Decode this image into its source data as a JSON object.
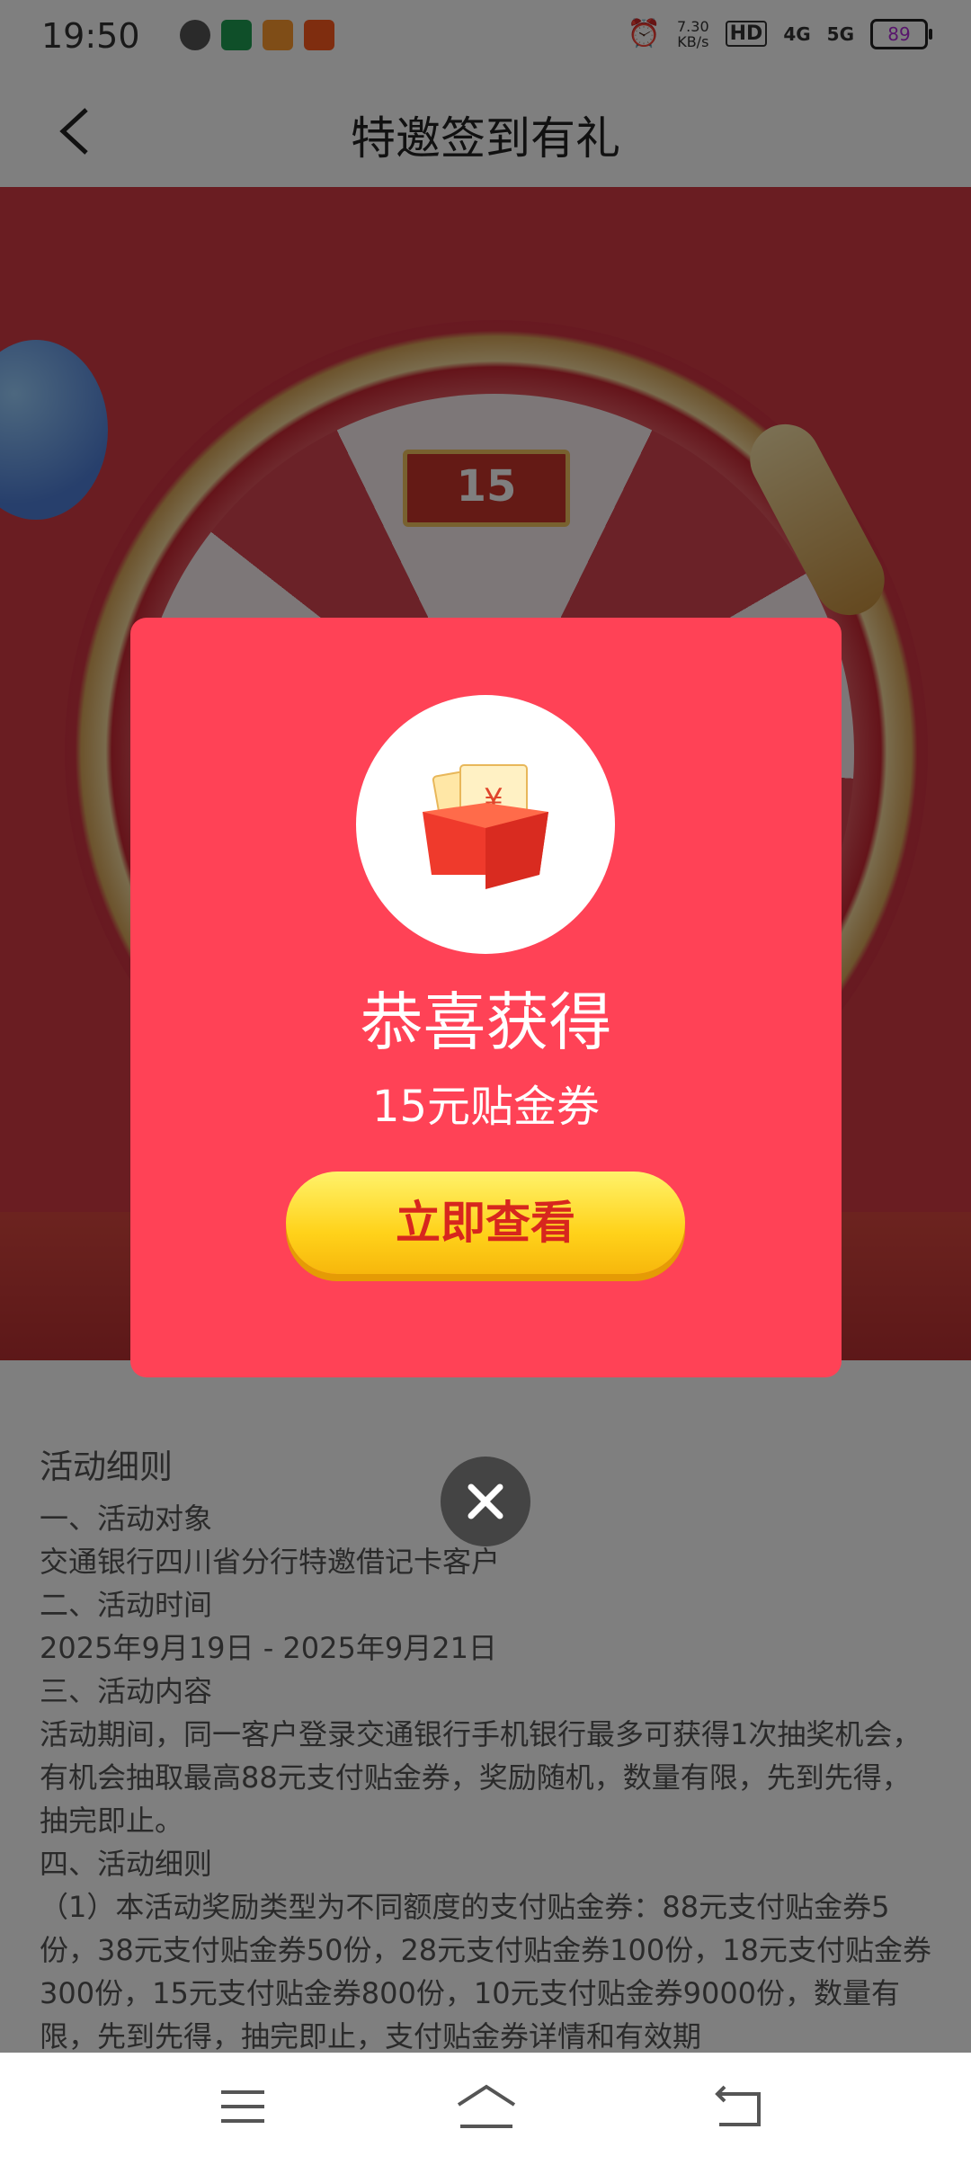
{
  "status_bar": {
    "time": "19:50",
    "net_speed_value": "7.30",
    "net_speed_unit": "KB/s",
    "hd_label": "HD",
    "signal_1": "4G",
    "signal_2": "5G",
    "battery": "89"
  },
  "header": {
    "title": "特邀签到有礼"
  },
  "wheel": {
    "ticket_value": "15"
  },
  "modal": {
    "heading": "恭喜获得",
    "prize": "15元贴金券",
    "button_label": "立即查看"
  },
  "rules": {
    "title": "活动细则",
    "lines": [
      "一、活动对象",
      "交通银行四川省分行特邀借记卡客户",
      "二、活动时间",
      "2025年9月19日 - 2025年9月21日",
      "三、活动内容",
      "活动期间，同一客户登录交通银行手机银行最多可获得1次抽奖机会，有机会抽取最高88元支付贴金券，奖励随机，数量有限，先到先得，抽完即止。",
      "四、活动细则",
      "（1）本活动奖励类型为不同额度的支付贴金券：88元支付贴金券5份，38元支付贴金券50份，28元支付贴金券100份，18元支付贴金券300份，15元支付贴金券800份，10元支付贴金券9000份，数量有限，先到先得，抽完即止，支付贴金券详情和有效期"
    ]
  },
  "icons": {
    "back": "chevron-left-icon",
    "close": "close-icon",
    "nav_menu": "menu-icon",
    "nav_home": "home-icon",
    "nav_back": "back-icon"
  },
  "colors": {
    "modal_bg": "#ff4256",
    "button_yellow": "#ffd21a",
    "button_text": "#d7261e",
    "hero_red": "#d43b45"
  }
}
